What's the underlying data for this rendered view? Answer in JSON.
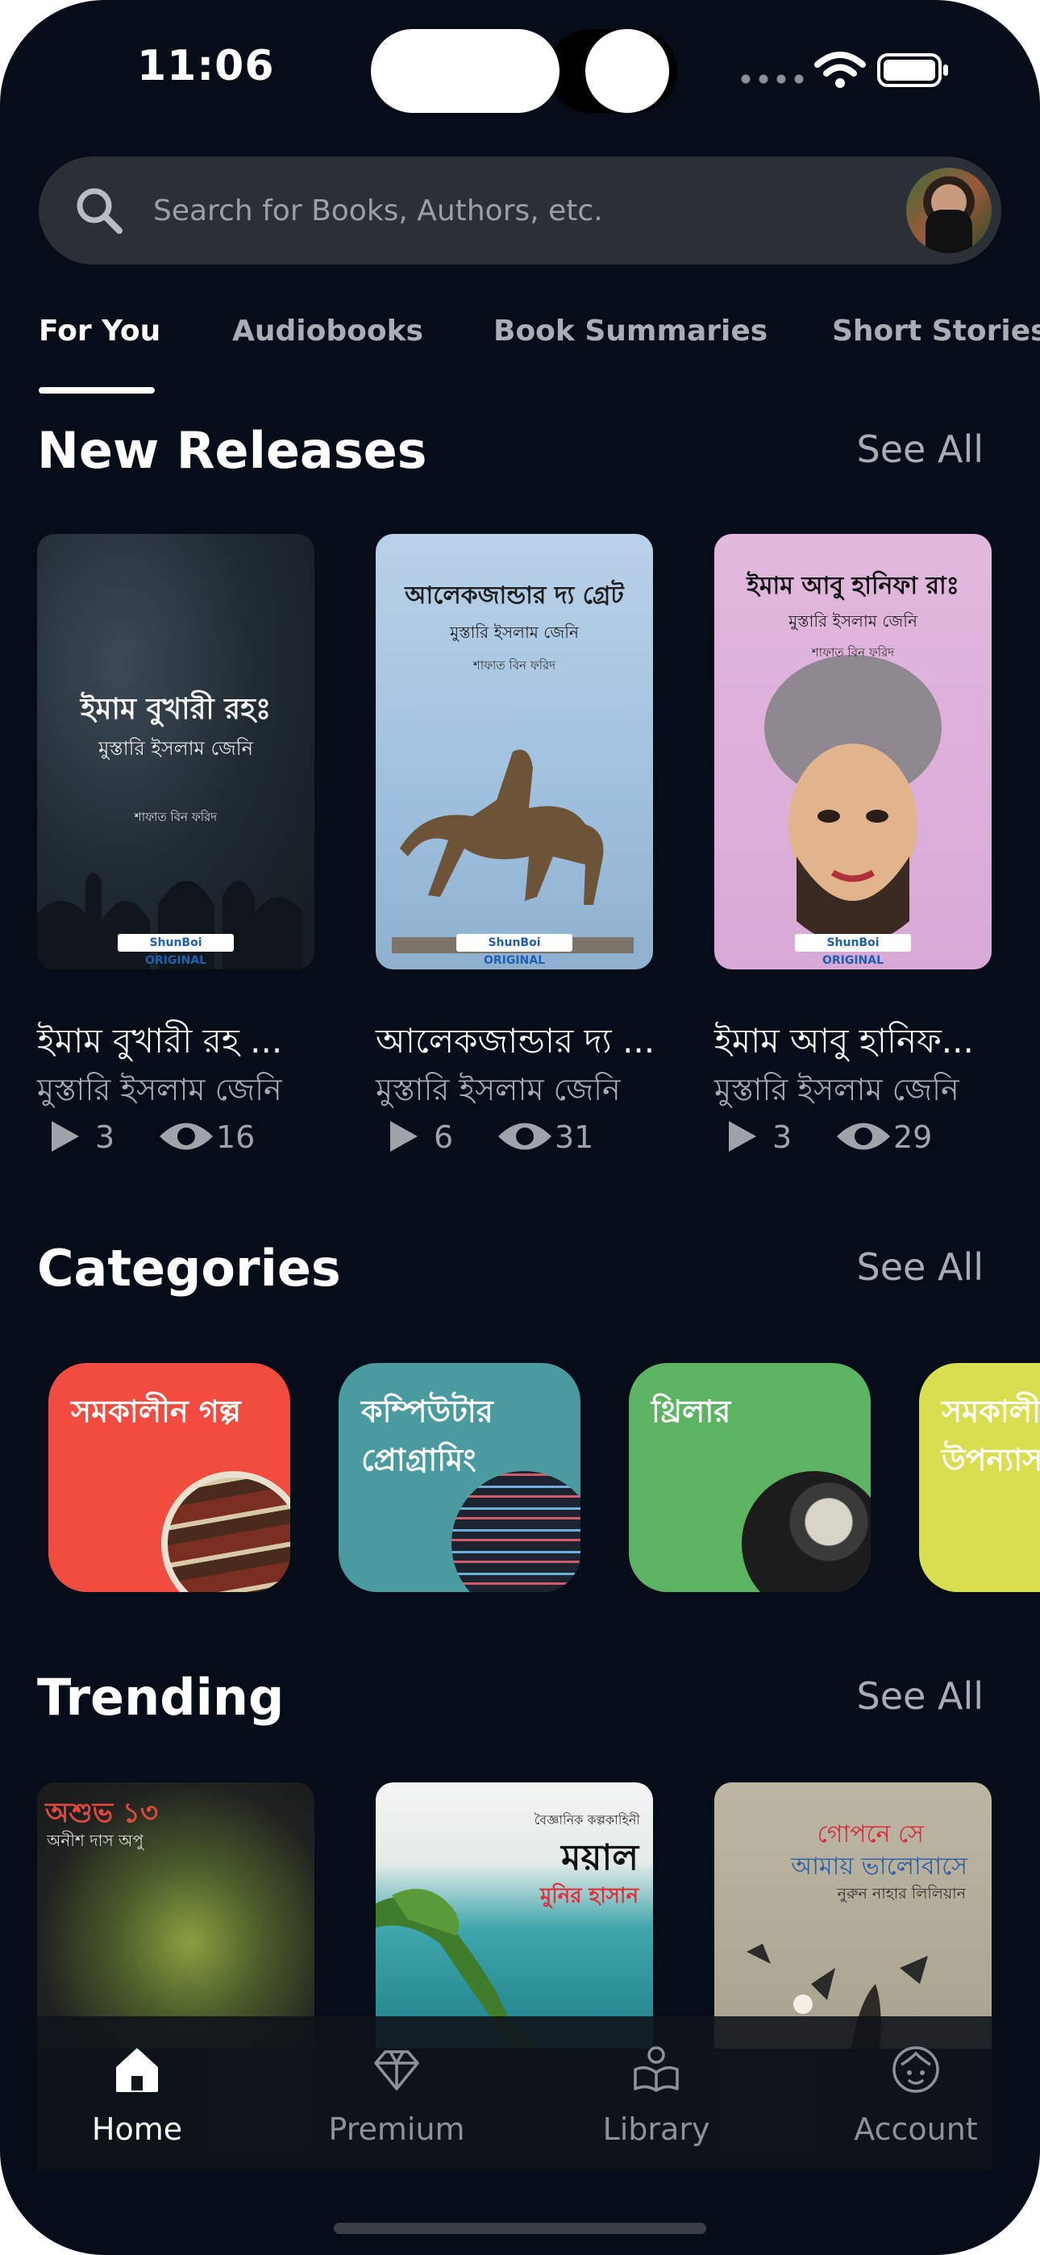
{
  "status_bar": {
    "time": "11:06"
  },
  "search": {
    "placeholder": "Search for Books, Authors, etc."
  },
  "tabs": [
    {
      "label": "For You",
      "active": true
    },
    {
      "label": "Audiobooks"
    },
    {
      "label": "Book Summaries"
    },
    {
      "label": "Short Stories"
    }
  ],
  "new_releases": {
    "title": "New Releases",
    "see_all": "See All",
    "books": [
      {
        "cover_title": "ইমাম বুখারী রহঃ",
        "cover_author": "মুস্তারি ইসলাম জেনি",
        "cover_credit": "শাফাত বিন ফরিদ",
        "badge": "ShunBoi ORIGINAL",
        "name": "ইমাম বুখারী রহ ...",
        "author": "মুস্তারি ইসলাম জেনি",
        "plays": "3",
        "views": "16"
      },
      {
        "cover_title": "আলেকজান্ডার দ্য গ্রেট",
        "cover_author": "মুস্তারি ইসলাম জেনি",
        "cover_credit": "শাফাত বিন ফরিদ",
        "badge": "ShunBoi ORIGINAL",
        "name": "আলেকজান্ডার দ্য ...",
        "author": "মুস্তারি ইসলাম জেনি",
        "plays": "6",
        "views": "31"
      },
      {
        "cover_title": "ইমাম আবু হানিফা রাঃ",
        "cover_author": "মুস্তারি ইসলাম জেনি",
        "cover_credit": "শাফাত বিন ফরিদ",
        "badge": "ShunBoi ORIGINAL",
        "name": "ইমাম আবু হানিফ...",
        "author": "মুস্তারি ইসলাম জেনি",
        "plays": "3",
        "views": "29"
      }
    ]
  },
  "categories": {
    "title": "Categories",
    "see_all": "See All",
    "items": [
      {
        "label": "সমকালীন গল্প",
        "color": "#f24b3f"
      },
      {
        "label": "কম্পিউটার প্রোগ্রামিং",
        "color": "#4a9ba0"
      },
      {
        "label": "থ্রিলার",
        "color": "#5cb463"
      },
      {
        "label": "সমকালীন উপন্যাস",
        "color": "#d9de50"
      }
    ]
  },
  "trending": {
    "title": "Trending",
    "see_all": "See All",
    "books": [
      {
        "title": "অশুভ ১৩",
        "author": "অনীশ দাস অপু"
      },
      {
        "kicker": "বৈজ্ঞানিক কল্পকাহিনী",
        "title": "ময়াল",
        "author": "মুনির হাসান"
      },
      {
        "title": "গোপনে সে",
        "title2": "আমায় ভালোবাসে",
        "author": "নুরুন নাহার লিলিয়ান"
      }
    ]
  },
  "bottom_nav": [
    {
      "label": "Home",
      "icon": "home-icon",
      "active": true
    },
    {
      "label": "Premium",
      "icon": "diamond-icon"
    },
    {
      "label": "Library",
      "icon": "book-icon"
    },
    {
      "label": "Account",
      "icon": "account-icon"
    }
  ]
}
